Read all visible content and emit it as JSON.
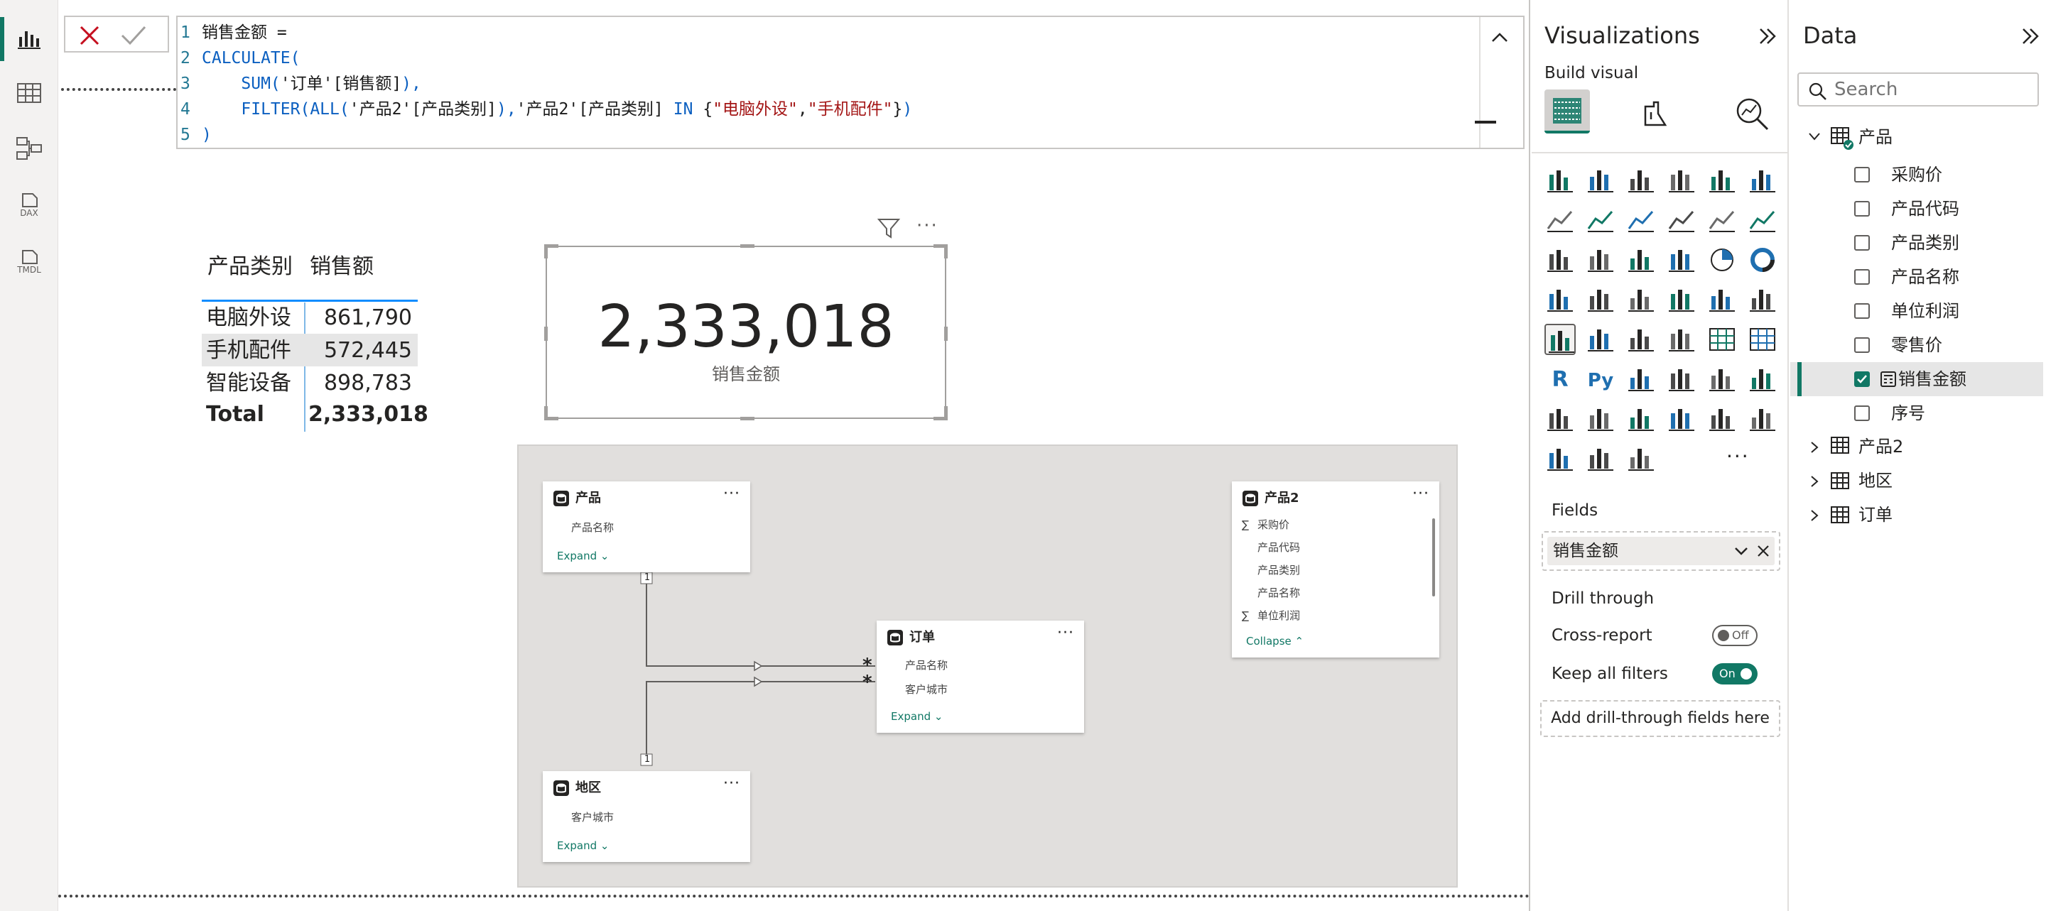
{
  "formula": {
    "line1": "销售金额 =",
    "line2": "CALCULATE(",
    "line3_fn": "SUM(",
    "line3_arg": "'订单'[销售额]",
    "line3_end": "),",
    "line4_fn1": "FILTER(",
    "line4_fn2": "ALL(",
    "line4_arg1": "'产品2'[产品类别]",
    "line4_mid": "),",
    "line4_arg2": "'产品2'[产品类别]",
    "line4_in": "IN",
    "line4_b1": "{",
    "line4_s1": "\"电脑外设\"",
    "line4_comma": ",",
    "line4_s2": "\"手机配件\"",
    "line4_b2": "}",
    "line4_end": ")",
    "line5": ")",
    "line_numbers": [
      "1",
      "2",
      "3",
      "4",
      "5"
    ]
  },
  "table_visual": {
    "headers": [
      "产品类别",
      "销售额"
    ],
    "rows": [
      {
        "category": "电脑外设",
        "value": "861,790"
      },
      {
        "category": "手机配件",
        "value": "572,445"
      },
      {
        "category": "智能设备",
        "value": "898,783"
      }
    ],
    "total_label": "Total",
    "total_value": "2,333,018"
  },
  "card_visual": {
    "value": "2,333,018",
    "label": "销售金额"
  },
  "model": {
    "product": {
      "title": "产品",
      "fields": [
        "产品名称"
      ],
      "link": "Expand"
    },
    "product2": {
      "title": "产品2",
      "fields": [
        "采购价",
        "产品代码",
        "产品类别",
        "产品名称",
        "单位利润"
      ],
      "sigma": [
        "∑",
        "",
        "",
        "",
        "∑"
      ],
      "link": "Collapse"
    },
    "orders": {
      "title": "订单",
      "fields": [
        "产品名称",
        "客户城市"
      ],
      "link": "Expand"
    },
    "region": {
      "title": "地区",
      "fields": [
        "客户城市"
      ],
      "link": "Expand"
    },
    "rel_one": "1",
    "rel_many": "*"
  },
  "visualizations": {
    "title": "Visualizations",
    "build_visual": "Build visual",
    "fields_label": "Fields",
    "field_well_value": "销售金额",
    "drill_through": "Drill through",
    "cross_report": "Cross-report",
    "cross_report_state": "Off",
    "keep_all_filters": "Keep all filters",
    "keep_all_filters_state": "On",
    "add_drill": "Add drill-through fields here",
    "more": "···"
  },
  "data_pane": {
    "title": "Data",
    "search_placeholder": "Search",
    "tables": [
      {
        "name": "产品",
        "expanded": true
      },
      {
        "name": "产品2",
        "expanded": false
      },
      {
        "name": "地区",
        "expanded": false
      },
      {
        "name": "订单",
        "expanded": false
      }
    ],
    "fields": [
      {
        "name": "采购价",
        "checked": false
      },
      {
        "name": "产品代码",
        "checked": false
      },
      {
        "name": "产品类别",
        "checked": false
      },
      {
        "name": "产品名称",
        "checked": false
      },
      {
        "name": "单位利润",
        "checked": false
      },
      {
        "name": "零售价",
        "checked": false
      },
      {
        "name": "销售金额",
        "checked": true
      },
      {
        "name": "序号",
        "checked": false
      }
    ]
  },
  "rail": {
    "dax_label": "DAX",
    "tmdl_label": "TMDL"
  },
  "colors": {
    "accent": "#117865",
    "selection": "#e6e6e6"
  }
}
